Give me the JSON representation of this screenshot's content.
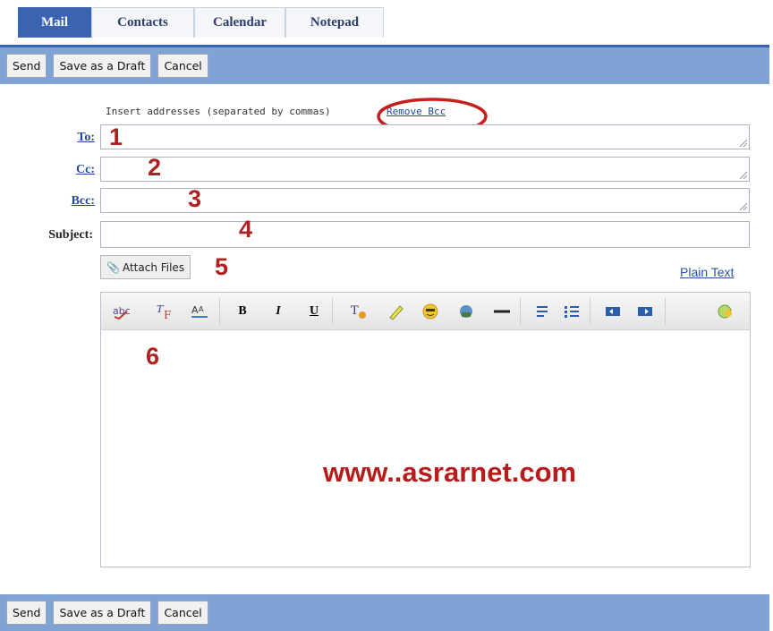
{
  "tabs": [
    {
      "label": "Mail",
      "active": true
    },
    {
      "label": "Contacts",
      "active": false
    },
    {
      "label": "Calendar",
      "active": false
    },
    {
      "label": "Notepad",
      "active": false
    }
  ],
  "toolbar": {
    "send_label": "Send",
    "draft_label": "Save as a Draft",
    "cancel_label": "Cancel"
  },
  "compose": {
    "hint": "Insert addresses (separated by commas)",
    "remove_bcc": "Remove Bcc",
    "to_label": "To:",
    "cc_label": "Cc:",
    "bcc_label": "Bcc:",
    "subject_label": "Subject:",
    "attach_label": "Attach Files",
    "plain_text_label": "Plain Text"
  },
  "annotations": [
    "1",
    "2",
    "3",
    "4",
    "5",
    "6"
  ],
  "editor": {
    "watermark": "www..asrarnet.com",
    "tools": [
      "spellcheck-icon",
      "font-icon",
      "font-size-icon",
      "bold-icon",
      "italic-icon",
      "underline-icon",
      "text-color-icon",
      "highlight-icon",
      "emoticon-icon",
      "image-icon",
      "horizontal-rule-icon",
      "numbered-list-icon",
      "bullet-list-icon",
      "outdent-icon",
      "indent-icon",
      "link-icon"
    ]
  },
  "colors": {
    "tab_active": "#3a63b2",
    "bar": "#7ea3d4",
    "annotation": "#b02020",
    "link": "#23479a"
  }
}
